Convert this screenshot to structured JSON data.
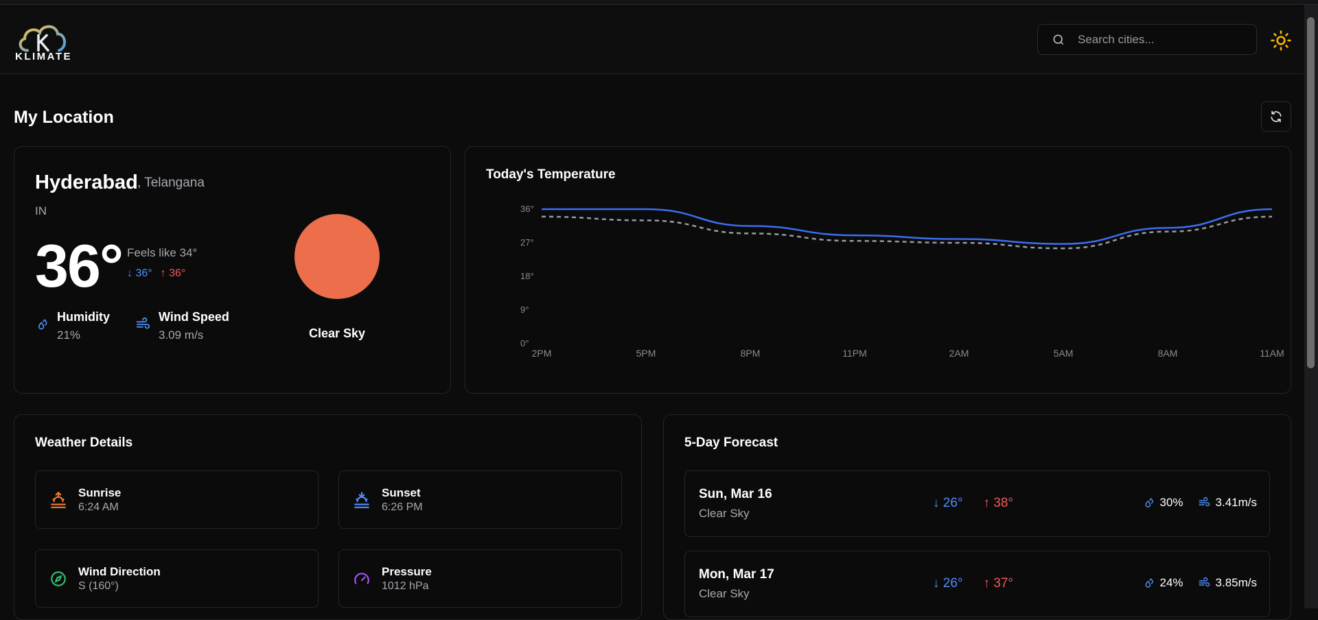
{
  "app": {
    "name": "KLIMATE"
  },
  "header": {
    "search_placeholder": "Search cities..."
  },
  "page": {
    "title": "My Location"
  },
  "current": {
    "city": "Hyderabad",
    "region": ", Telangana",
    "country": "IN",
    "temperature": "36°",
    "feels_like": "Feels like 34°",
    "min": "36°",
    "max": "36°",
    "humidity_label": "Humidity",
    "humidity_value": "21%",
    "wind_label": "Wind Speed",
    "wind_value": "3.09 m/s",
    "description": "Clear Sky",
    "icon": "clear-sky-sun-icon"
  },
  "chart_title": "Today's Temperature",
  "chart_data": {
    "type": "line",
    "categories": [
      "2PM",
      "5PM",
      "8PM",
      "11PM",
      "2AM",
      "5AM",
      "8AM",
      "11AM"
    ],
    "series": [
      {
        "values": [
          36,
          36,
          31.5,
          29,
          28,
          26.7,
          31,
          36
        ],
        "color": "#3b6ff2",
        "style": "solid"
      },
      {
        "values": [
          34,
          33,
          29.5,
          27.5,
          27,
          25.5,
          30,
          34
        ],
        "color": "#9a9aa2",
        "style": "dashed"
      }
    ],
    "yticks": [
      "0°",
      "9°",
      "18°",
      "27°",
      "36°"
    ],
    "ylim": [
      0,
      36
    ],
    "grid": false
  },
  "details": {
    "title": "Weather Details",
    "items": [
      {
        "label": "Sunrise",
        "value": "6:24 AM",
        "icon": "sunrise-icon"
      },
      {
        "label": "Sunset",
        "value": "6:26 PM",
        "icon": "sunset-icon"
      },
      {
        "label": "Wind Direction",
        "value": "S (160°)",
        "icon": "compass-icon"
      },
      {
        "label": "Pressure",
        "value": "1012 hPa",
        "icon": "gauge-icon"
      }
    ]
  },
  "forecast": {
    "title": "5-Day Forecast",
    "days": [
      {
        "day": "Sun, Mar 16",
        "desc": "Clear Sky",
        "min": "26°",
        "max": "38°",
        "humidity": "30%",
        "wind": "3.41m/s"
      },
      {
        "day": "Mon, Mar 17",
        "desc": "Clear Sky",
        "min": "26°",
        "max": "37°",
        "humidity": "24%",
        "wind": "3.85m/s"
      }
    ]
  },
  "colors": {
    "accent_blue": "#4f8ff7",
    "accent_red": "#f25a5a",
    "sun": "#ec6e4b",
    "theme_icon": "#f5b300"
  }
}
